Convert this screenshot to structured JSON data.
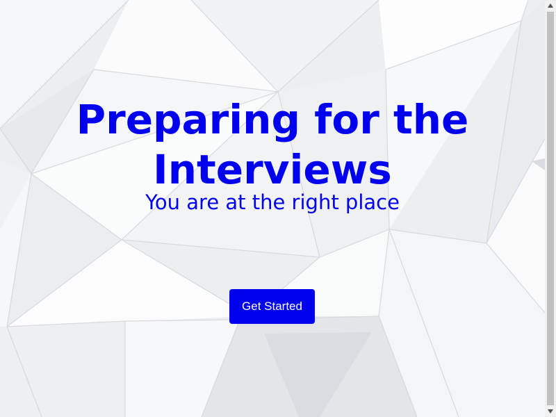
{
  "hero": {
    "title": "Preparing for the Interviews",
    "subtitle": "You are at the right place"
  },
  "cta": {
    "label": "Get Started"
  },
  "icons": {
    "scroll_up": "chevron-up-icon",
    "scroll_down": "chevron-down-icon"
  },
  "colors": {
    "accent": "#0000ee",
    "button_text": "#ffffff",
    "background": "#eef0f2"
  }
}
